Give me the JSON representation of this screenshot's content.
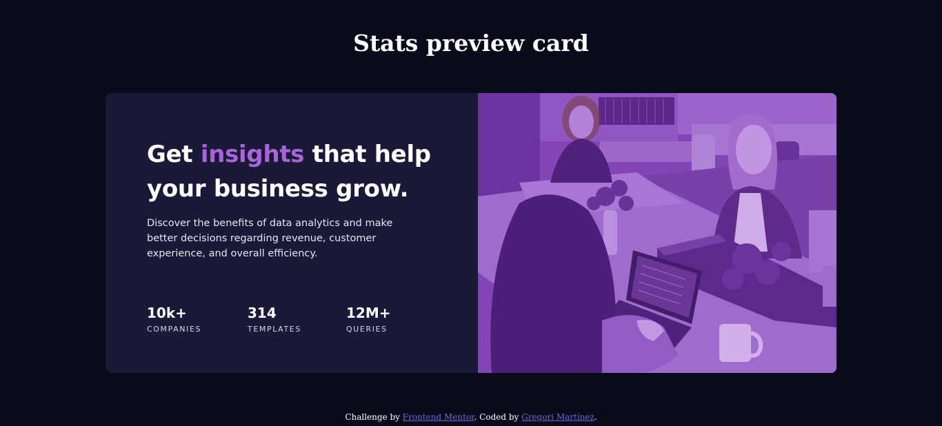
{
  "page": {
    "title": "Stats preview card"
  },
  "card": {
    "headline_part1": "Get ",
    "headline_accent": "insights",
    "headline_part2": " that help your business grow.",
    "description": "Discover the benefits of data analytics and make better decisions regarding revenue, customer experience, and overall efficiency.",
    "stats": [
      {
        "value": "10k+",
        "label": "COMPANIES"
      },
      {
        "value": "314",
        "label": "TEMPLATES"
      },
      {
        "value": "12M+",
        "label": "QUERIES"
      }
    ],
    "image_description": "photo-office-women-working-purple-overlay"
  },
  "footer": {
    "prefix": "Challenge by ",
    "link1": "Frontend Mentor",
    "middle": ". Coded by ",
    "link2": "Gregori Martínez",
    "suffix": "."
  },
  "colors": {
    "background": "#090b1a",
    "card": "#1b1938",
    "accent": "#a964db",
    "image_overlay": "#7a3fae",
    "link": "#6b6ad6"
  }
}
